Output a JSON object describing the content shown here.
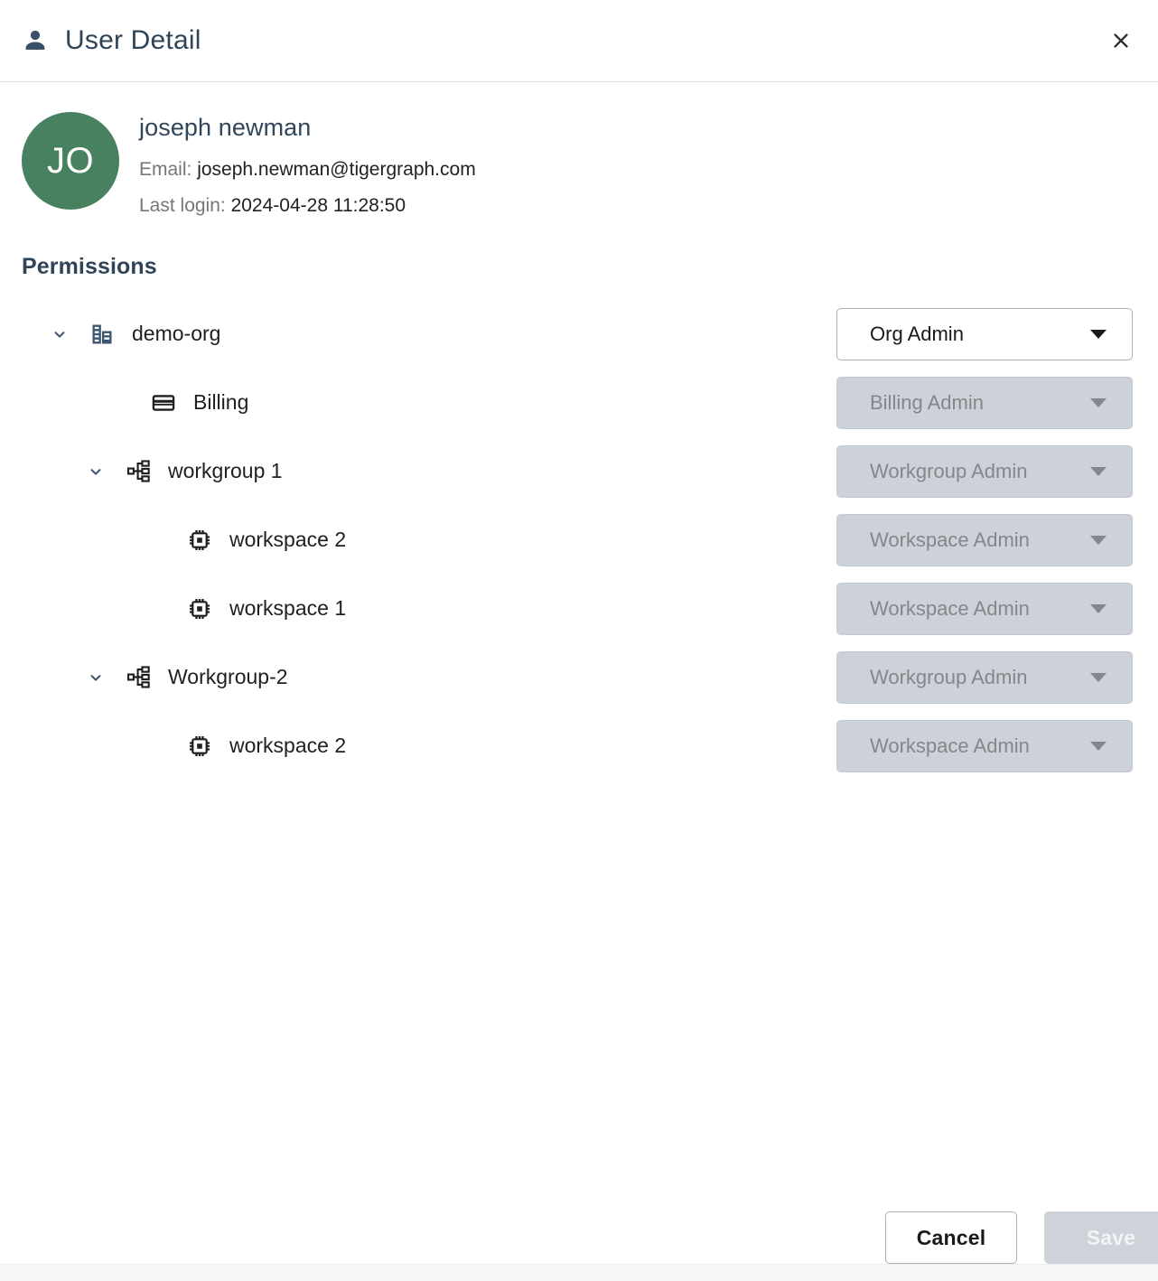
{
  "header": {
    "title": "User Detail",
    "user_icon": "person-icon",
    "close_icon": "close-icon"
  },
  "user": {
    "avatar_initials": "JO",
    "avatar_color": "#478160",
    "name": "joseph newman",
    "email_label": "Email:",
    "email_value": "joseph.newman@tigergraph.com",
    "last_login_label": "Last login:",
    "last_login_value": "2024-04-28 11:28:50"
  },
  "permissions": {
    "title": "Permissions",
    "rows": [
      {
        "label": "demo-org",
        "icon": "corporate-building-icon",
        "level": 0,
        "expandable": true,
        "role": "Org Admin",
        "role_enabled": true
      },
      {
        "label": "Billing",
        "icon": "credit-card-icon",
        "level": 1,
        "expandable": false,
        "role": "Billing Admin",
        "role_enabled": false
      },
      {
        "label": "workgroup 1",
        "icon": "account-tree-icon",
        "level": 2,
        "expandable": true,
        "role": "Workgroup Admin",
        "role_enabled": false
      },
      {
        "label": "workspace 2",
        "icon": "cpu-chip-icon",
        "level": 3,
        "expandable": false,
        "role": "Workspace Admin",
        "role_enabled": false
      },
      {
        "label": "workspace 1",
        "icon": "cpu-chip-icon",
        "level": 3,
        "expandable": false,
        "role": "Workspace Admin",
        "role_enabled": false
      },
      {
        "label": "Workgroup-2",
        "icon": "account-tree-icon",
        "level": 2,
        "expandable": true,
        "role": "Workgroup Admin",
        "role_enabled": false
      },
      {
        "label": "workspace 2",
        "icon": "cpu-chip-icon",
        "level": 3,
        "expandable": false,
        "role": "Workspace Admin",
        "role_enabled": false
      }
    ]
  },
  "footer": {
    "cancel_label": "Cancel",
    "save_label": "Save",
    "save_enabled": false
  }
}
